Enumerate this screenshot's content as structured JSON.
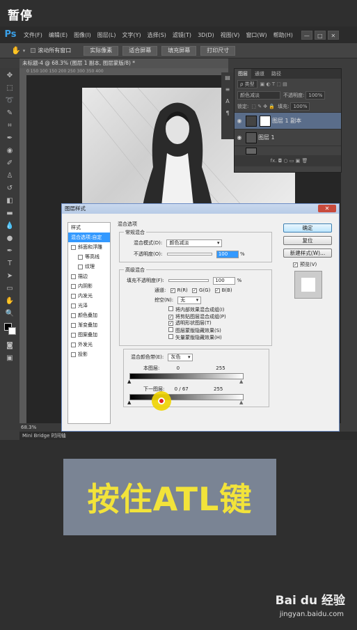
{
  "top_label": "暂停",
  "menubar": {
    "logo": "Ps",
    "items": [
      "文件(F)",
      "编辑(E)",
      "图像(I)",
      "图层(L)",
      "文字(Y)",
      "选择(S)",
      "滤镜(T)",
      "3D(D)",
      "视图(V)",
      "窗口(W)",
      "帮助(H)"
    ],
    "win_min": "—",
    "win_max": "□",
    "win_close": "✕"
  },
  "options_bar": {
    "checkbox_label": "滚动所有窗口",
    "buttons": [
      "实际像素",
      "适合屏幕",
      "填充屏幕",
      "打印尺寸"
    ]
  },
  "doc_tab": "未标题-4 @ 68.3% (图层 1 副本, 图层蒙版/8) *",
  "ruler_text": "0   150   100   150   200   250   300   350   400",
  "status_zoom": "68.3%",
  "bottom_tabs": "Mini Bridge   时间轴",
  "layers_panel": {
    "tabs": [
      "图层",
      "通道",
      "路径"
    ],
    "kind_label": "ρ 类型",
    "blend_mode": "颜色减淡",
    "opacity_label": "不透明度:",
    "opacity_value": "100%",
    "lock_label": "锁定:",
    "fill_label": "填充:",
    "fill_value": "100%",
    "layers": [
      {
        "name": "图层 1 副本",
        "selected": true
      },
      {
        "name": "图层 1",
        "selected": false
      },
      {
        "name": "",
        "selected": false
      }
    ],
    "footer_icons": "fx. ◘ ○ ▭ ▣ 🗑"
  },
  "dialog": {
    "title": "图层样式",
    "close": "✕",
    "styles": [
      {
        "label": "样式",
        "check": false,
        "header": true
      },
      {
        "label": "混合选项:自定",
        "check": false,
        "active": true
      },
      {
        "label": "斜面和浮雕",
        "check": true
      },
      {
        "label": "等高线",
        "check": true,
        "indent": true
      },
      {
        "label": "纹理",
        "check": true,
        "indent": true
      },
      {
        "label": "描边",
        "check": true
      },
      {
        "label": "内阴影",
        "check": true
      },
      {
        "label": "内发光",
        "check": true
      },
      {
        "label": "光泽",
        "check": true
      },
      {
        "label": "颜色叠加",
        "check": true
      },
      {
        "label": "渐变叠加",
        "check": true
      },
      {
        "label": "图案叠加",
        "check": true
      },
      {
        "label": "外发光",
        "check": true
      },
      {
        "label": "投影",
        "check": true
      }
    ],
    "blend_options_label": "混合选项",
    "general_label": "常规混合",
    "blend_mode_label": "混合模式(D):",
    "blend_mode_value": "颜色减淡",
    "opacity_label": "不透明度(O):",
    "opacity_value": "100",
    "advanced_label": "高级混合",
    "fill_opacity_label": "填充不透明度(F):",
    "fill_opacity_value": "100",
    "percent": "%",
    "channels_label": "通道:",
    "channels": [
      "R(R)",
      "G(G)",
      "B(B)"
    ],
    "knockout_label": "挖空(N):",
    "knockout_value": "无",
    "checks": [
      {
        "label": "将内部效果混合成组(I)",
        "checked": false
      },
      {
        "label": "将剪贴图层混合成组(P)",
        "checked": true
      },
      {
        "label": "透明形状图层(T)",
        "checked": true
      },
      {
        "label": "图层蒙版隐藏效果(S)",
        "checked": false
      },
      {
        "label": "矢量蒙版隐藏效果(H)",
        "checked": false
      }
    ],
    "blend_if_label": "混合颜色带(E):",
    "blend_if_value": "灰色",
    "this_layer_label": "本图层:",
    "this_layer_min": "0",
    "this_layer_max": "255",
    "underlying_label": "下一图层:",
    "underlying_values": "0  /  67",
    "underlying_max": "255",
    "btn_ok": "确定",
    "btn_reset": "复位",
    "btn_new_style": "新建样式(W)...",
    "preview_label": "预览(V)"
  },
  "caption": "按住ATL键",
  "watermark": {
    "brand": "Bai du 经验",
    "url": "jingyan.baidu.com"
  }
}
